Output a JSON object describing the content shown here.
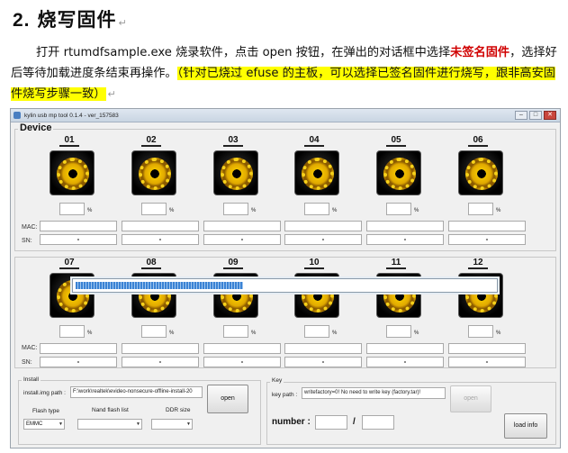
{
  "doc": {
    "heading_num": "2.",
    "heading_text": "烧写固件",
    "para_intro": "打开 rtumdfsample.exe 烧录软件，点击 open 按钮，在弹出的对话框中选择",
    "para_red": "未签名固件",
    "para_mid": "，选择好后等待加载进度条结束再操作。",
    "para_highlight": "（针对已烧过 efuse 的主板，可以选择已签名固件进行烧写，跟非高安固件烧写步骤一致）"
  },
  "window": {
    "title": "kylin usb mp tool 0.1.4 - ver_157583",
    "device_label": "Device",
    "mac_label": "MAC:",
    "sn_label": "SN:",
    "pct_symbol": "%",
    "sn_placeholder": "-",
    "loading_progress": 0.4,
    "ports_row1": [
      "01",
      "02",
      "03",
      "04",
      "05",
      "06"
    ],
    "ports_row2": [
      "07",
      "08",
      "09",
      "10",
      "11",
      "12"
    ],
    "install": {
      "group_label": "Install",
      "img_path_label": "install.img path :",
      "img_path_value": "F:\\work\\realtek\\evideo-nonsecure-offline-install-20",
      "open_label": "open",
      "flash_type_label": "Flash type",
      "flash_type_value": "EMMC",
      "nand_label": "Nand flash list",
      "nand_value": "",
      "ddr_label": "DDR size",
      "ddr_value": ""
    },
    "key": {
      "group_label": "Key",
      "key_path_label": "key path :",
      "key_path_value": "writefactory=0! No need to write key (factory.tar)!",
      "open_label": "open",
      "number_label": "number :",
      "slash": "/",
      "number_value": "",
      "number_total": "",
      "load_info_label": "load info"
    }
  },
  "colors": {
    "highlight": "#ffff00",
    "red_text": "#d00000",
    "progress": "#3a82d4"
  }
}
